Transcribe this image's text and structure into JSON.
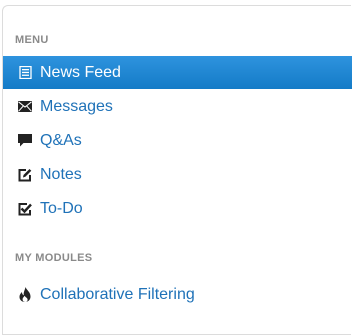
{
  "menu": {
    "header": "MENU",
    "items": [
      {
        "label": "News Feed",
        "icon": "list-icon",
        "active": true
      },
      {
        "label": "Messages",
        "icon": "envelope-icon",
        "active": false
      },
      {
        "label": "Q&As",
        "icon": "comment-icon",
        "active": false
      },
      {
        "label": "Notes",
        "icon": "edit-icon",
        "active": false
      },
      {
        "label": "To-Do",
        "icon": "checkbox-icon",
        "active": false
      }
    ]
  },
  "modules": {
    "header": "MY MODULES",
    "items": [
      {
        "label": "Collaborative Filtering",
        "icon": "fire-icon",
        "active": false
      }
    ]
  },
  "colors": {
    "accent": "#1a86d4",
    "link": "#1f72b8",
    "header_text": "#8a8a8a"
  }
}
